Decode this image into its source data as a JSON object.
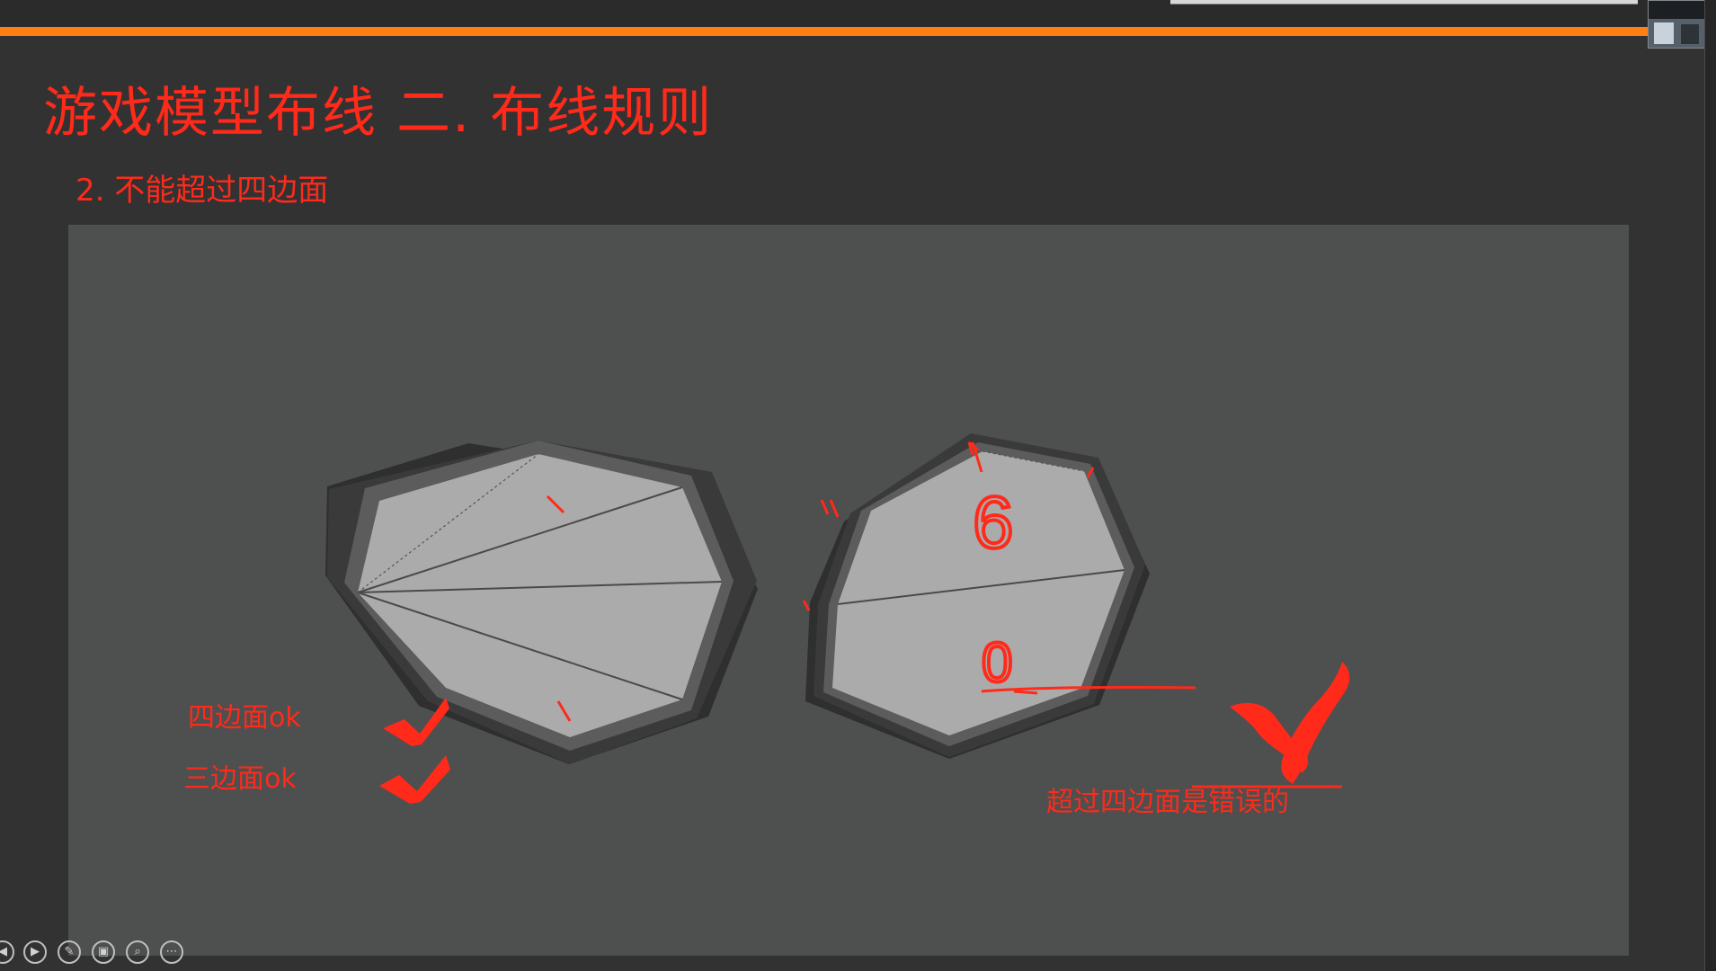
{
  "slide": {
    "title": "游戏模型布线  二. 布线规则",
    "subtitle": "2. 不能超过四边面",
    "notes": {
      "quad_ok": "四边面ok",
      "tri_ok": "三边面ok",
      "ngon_wrong": "超过四边面是错误的"
    },
    "annotations": {
      "count_top": "6",
      "count_bottom": "0"
    }
  },
  "colors": {
    "accent": "#ff2a1a",
    "orange_bar": "#ff7f14",
    "background": "#323232",
    "canvas": "#4e4f4f",
    "face": "#aaaaaa"
  },
  "player_controls": [
    {
      "name": "previous-icon",
      "glyph": "◀"
    },
    {
      "name": "play-icon",
      "glyph": "▶"
    },
    {
      "name": "pen-icon",
      "glyph": "✎"
    },
    {
      "name": "slides-icon",
      "glyph": "▣"
    },
    {
      "name": "zoom-icon",
      "glyph": "⌕"
    },
    {
      "name": "more-icon",
      "glyph": "⋯"
    }
  ]
}
